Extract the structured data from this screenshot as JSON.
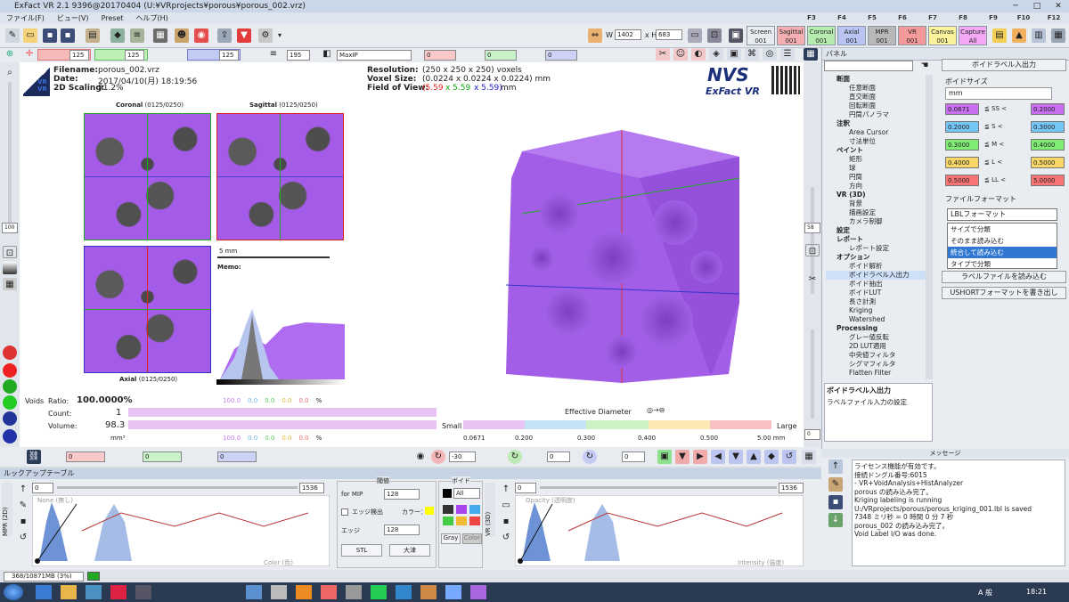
{
  "window": {
    "title": "ExFact VR 2.1 9396@20170404 (U:¥VRprojects¥porous¥porous_002.vrz)",
    "controls": [
      "─",
      "□",
      "✕"
    ]
  },
  "menu": [
    "ファイル(F)",
    "ビュー(V)",
    "Preset",
    "ヘルプ(H)"
  ],
  "fkeys": [
    "F3",
    "F4",
    "F5",
    "F6",
    "F7",
    "F8",
    "F9",
    "F10",
    "F12"
  ],
  "presets": [
    {
      "l1": "Screen",
      "l2": "001",
      "bg": "#e8ecf1"
    },
    {
      "l1": "Sagittal",
      "l2": "001",
      "bg": "#f4b0b0"
    },
    {
      "l1": "Coronal",
      "l2": "001",
      "bg": "#b7ecb0"
    },
    {
      "l1": "Axial",
      "l2": "001",
      "bg": "#b8c4f2"
    },
    {
      "l1": "MPR",
      "l2": "001",
      "bg": "#b9b9b9"
    },
    {
      "l1": "VR",
      "l2": "001",
      "bg": "#f59a9a"
    },
    {
      "l1": "Canvas",
      "l2": "001",
      "bg": "#fbf39c"
    },
    {
      "l1": "Capture",
      "l2": "All",
      "bg": "#f3a9f3"
    }
  ],
  "window_size": {
    "w_label": "W",
    "w": "1402",
    "h_label": "x H",
    "h": "683"
  },
  "slice_toolbar": {
    "coronal": "125",
    "sagittal": "125",
    "axial": "125",
    "thickness": "195",
    "mode": "MaxIP",
    "r": "0",
    "g": "0",
    "b": "0"
  },
  "left_zoom": "100",
  "right_zoom": "58",
  "right_zoom2": "0",
  "info": {
    "filename_label": "Filename:",
    "filename": "porous_002.vrz",
    "date_label": "Date:",
    "date": "2017/04/10(月) 18:19:56",
    "scaling_label": "2D Scaling:",
    "scaling": "91.2%",
    "res_label": "Resolution:",
    "res": "(250 x 250 x 250) voxels",
    "voxel_label": "Voxel Size:",
    "voxel": "(0.0224 x 0.0224 x 0.0224) mm",
    "fov_label": "Field of View:",
    "fov_a": "(5.59",
    "fov_b": "x 5.59",
    "fov_c": "x 5.59)",
    "fov_unit": "mm",
    "logo1": "NVS",
    "logo2": "ExFact VR",
    "badge_top": "VR",
    "badge_bottom": "VR"
  },
  "views": {
    "coronal": "Coronal",
    "coronal_idx": "(0125/0250)",
    "sagittal": "Sagittal",
    "sagittal_idx": "(0125/0250)",
    "axial": "Axial",
    "axial_idx": "(0125/0250)",
    "scale": "5 mm",
    "memo": "Memo:"
  },
  "stats": {
    "voids": "Voids",
    "ratio_label": "Ratio:",
    "ratio": "100.0000%",
    "count_label": "Count:",
    "count": "1",
    "volume_label": "Volume:",
    "volume": "98.3",
    "volume_unit": "mm³",
    "row1": {
      "a": "100.0",
      "b": "0.0",
      "c": "0.0",
      "d": "0.0",
      "e": "0.0",
      "unit": "%"
    },
    "row2": {
      "a": "100.0",
      "b": "0.0",
      "c": "0.0",
      "d": "0.0",
      "e": "0.0",
      "unit": "%"
    },
    "small": "Small",
    "large": "Large",
    "eff": "Effective Diameter",
    "ticks": [
      "0.0671",
      "0.200",
      "0.300",
      "0.400",
      "0.500",
      "5.00 mm"
    ]
  },
  "bottom_toolbar": {
    "v1": "0",
    "v2": "0",
    "v3": "0",
    "v4": "-30",
    "v5": "0",
    "v6": "0",
    "v7": "0",
    "v8": "0"
  },
  "panel": {
    "title": "パネル",
    "tree": [
      {
        "t": "断面",
        "g": true
      },
      {
        "t": "任意断面"
      },
      {
        "t": "直交断面"
      },
      {
        "t": "回転断面"
      },
      {
        "t": "円筒パノラマ"
      },
      {
        "t": "注釈",
        "g": true
      },
      {
        "t": "Area Cursor"
      },
      {
        "t": "寸法単位"
      },
      {
        "t": "ペイント",
        "g": true
      },
      {
        "t": "矩形"
      },
      {
        "t": "球"
      },
      {
        "t": "円筒"
      },
      {
        "t": "方向"
      },
      {
        "t": "VR (3D)",
        "g": true
      },
      {
        "t": "背景"
      },
      {
        "t": "描画設定"
      },
      {
        "t": "カメラ制御"
      },
      {
        "t": "設定",
        "g": true
      },
      {
        "t": "レポート",
        "g": true
      },
      {
        "t": "レポート設定"
      },
      {
        "t": "オプション",
        "g": true
      },
      {
        "t": "ボイド解析"
      },
      {
        "t": "ボイドラベル入出力",
        "sel": true
      },
      {
        "t": "ボイド抽出"
      },
      {
        "t": "ボイドLUT"
      },
      {
        "t": "長さ計測"
      },
      {
        "t": "Kriging"
      },
      {
        "t": "Watershed"
      },
      {
        "t": "Processing",
        "g": true
      },
      {
        "t": "グレー値反転"
      },
      {
        "t": "2D LUT適用"
      },
      {
        "t": "中央値フィルタ"
      },
      {
        "t": "シグマフィルタ"
      },
      {
        "t": "Flatten Filter"
      }
    ],
    "desc_title": "ボイドラベル入出力",
    "desc": "ラベルファイル入力の設定",
    "header_btn": "ボイドラベル入出力",
    "void_size": "ボイドサイズ",
    "unit": "mm",
    "sizes": [
      {
        "lo": "0.0671",
        "op": "≦ SS <",
        "hi": "0.2000",
        "c": "#c86ff0"
      },
      {
        "lo": "0.2000",
        "op": "≦ S <",
        "hi": "0.3000",
        "c": "#74c6f5"
      },
      {
        "lo": "0.3000",
        "op": "≦ M <",
        "hi": "0.4000",
        "c": "#7fec74"
      },
      {
        "lo": "0.4000",
        "op": "≦ L <",
        "hi": "0.5000",
        "c": "#f8d668"
      },
      {
        "lo": "0.5000",
        "op": "≦ LL <",
        "hi": "5.0000",
        "c": "#f77474"
      }
    ],
    "file_format": "ファイルフォーマット",
    "format_value": "LBLフォーマット",
    "dropdown": [
      "サイズで分類",
      "そのまま読み込む",
      "統合して読み込む",
      "タイプで分類"
    ],
    "load_btn": "ラベルファイルを読み込む",
    "write_btn": "USHORTフォーマットを書き出し"
  },
  "lut": {
    "title": "ルックアップテーブル",
    "min": "0",
    "max": "1536",
    "left_label": "None (無し)",
    "bottom_label": "Color (色)",
    "tab_left": "MPR (2D)",
    "tab_right": "VR (3D)",
    "mid_title": "閾値",
    "for_mip": "for MIP",
    "mip_val": "128",
    "edge_detect": "エッジ検出",
    "color_label": "カラー：",
    "edge": "エッジ",
    "edge_val": "128",
    "stl": "STL",
    "otsu": "大津",
    "void_title": "ボイド",
    "all": "All",
    "gray": "Gray",
    "color": "Color",
    "r_min": "0",
    "r_max": "1536",
    "r_label": "Opacity (透明度)",
    "r_bottom": "Intensity (強度)"
  },
  "messages": {
    "title": "メッセージ",
    "lines": [
      "ライセンス機能が有効です。",
      "接続ドングル番号:6015",
      "- VR+VoidAnalysis+HistAnalyzer",
      "porous の読み込み完了。",
      "Kriging labeling is running",
      "U:/VRprojects/porous/porous_kriging_001.lbl is saved",
      "7348 ミリ秒 = 0 時間 0 分 7 秒",
      "porous_002 の読み込み完了。",
      "Void Label I/O was done."
    ]
  },
  "status": {
    "mem": "368/10871MB (3%)"
  },
  "taskbar": {
    "time": "18:21",
    "ime": "A 般"
  }
}
